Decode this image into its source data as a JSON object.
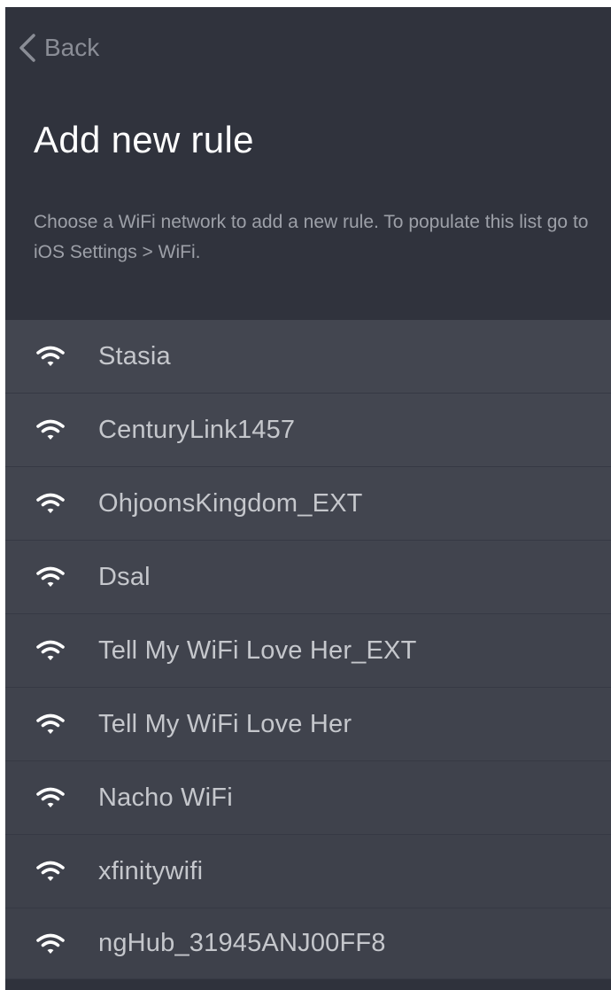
{
  "nav": {
    "back_label": "Back"
  },
  "header": {
    "title": "Add new rule",
    "description": "Choose a WiFi network to add a new rule. To populate this list go to iOS Settings > WiFi."
  },
  "networks": [
    {
      "ssid": "Stasia",
      "icon": "wifi-icon"
    },
    {
      "ssid": "CenturyLink1457",
      "icon": "wifi-icon"
    },
    {
      "ssid": "OhjoonsKingdom_EXT",
      "icon": "wifi-icon"
    },
    {
      "ssid": "Dsal",
      "icon": "wifi-icon"
    },
    {
      "ssid": "Tell My WiFi Love Her_EXT",
      "icon": "wifi-icon"
    },
    {
      "ssid": "Tell My WiFi Love Her",
      "icon": "wifi-icon"
    },
    {
      "ssid": "Nacho WiFi",
      "icon": "wifi-icon"
    },
    {
      "ssid": "xfinitywifi",
      "icon": "wifi-icon"
    },
    {
      "ssid": "ngHub_31945ANJ00FF8",
      "icon": "wifi-icon"
    }
  ],
  "colors": {
    "background": "#2f323c",
    "row": "#434650",
    "divider": "#363944",
    "title": "#ffffff",
    "text": "#c5c7cc",
    "muted": "#9da0a8"
  }
}
